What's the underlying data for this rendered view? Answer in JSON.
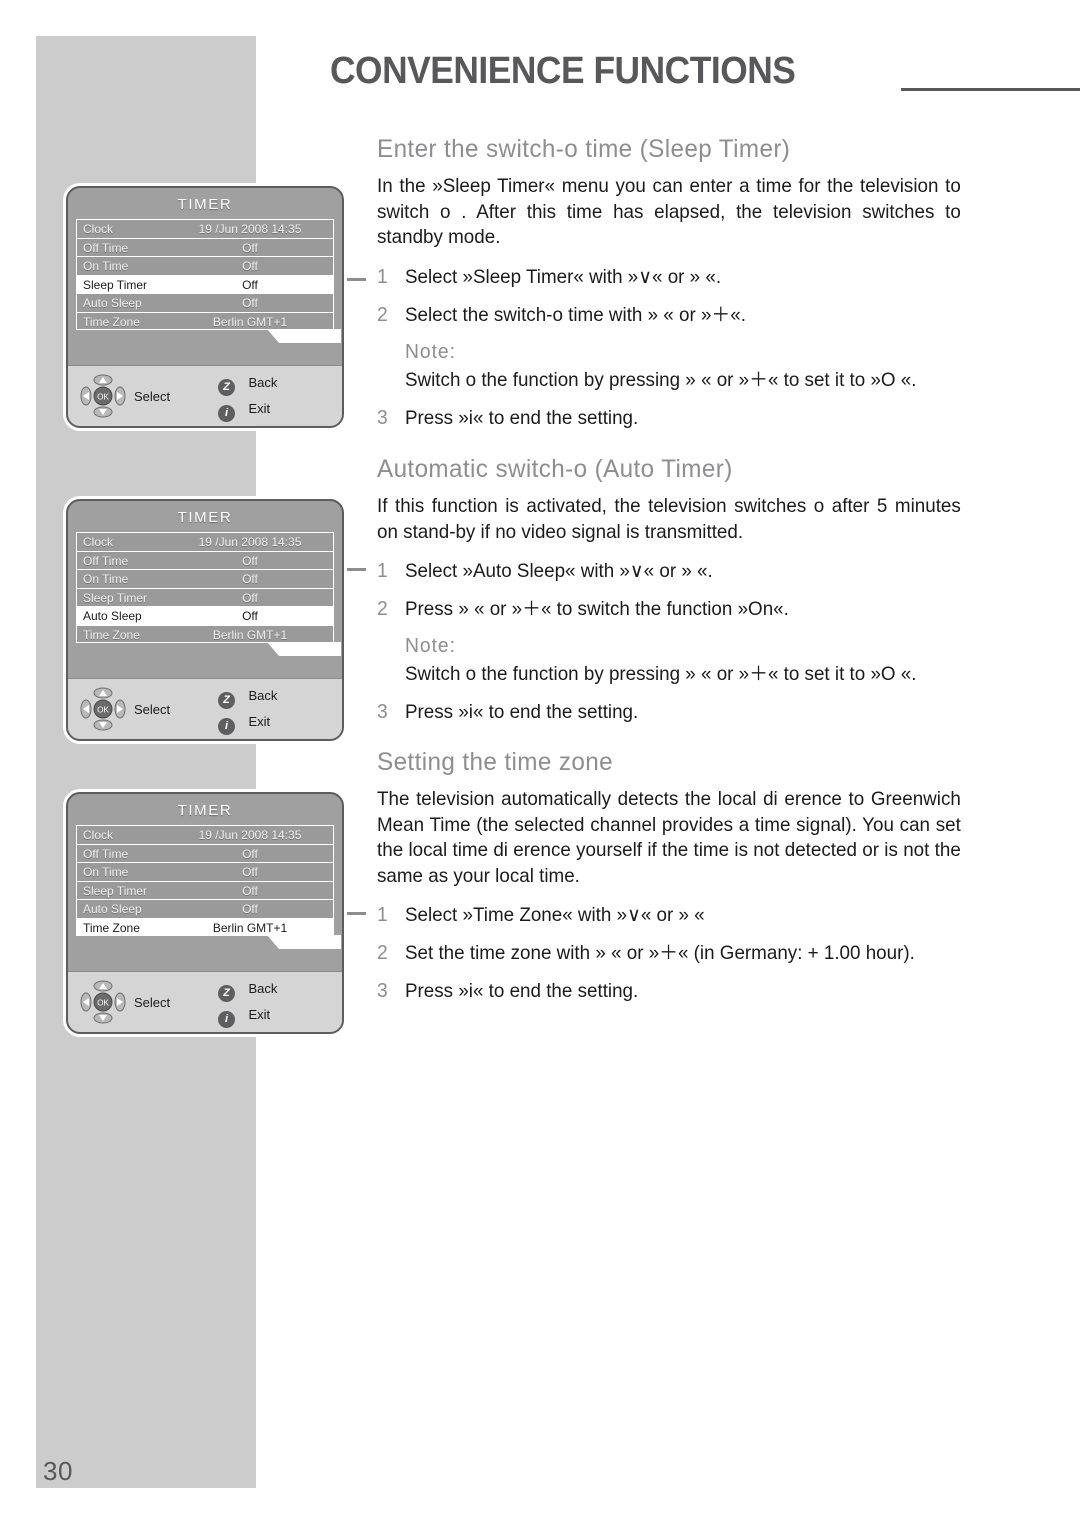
{
  "page": {
    "number": "30"
  },
  "chapter": {
    "title": "CONVENIENCE FUNCTIONS"
  },
  "sections": [
    {
      "heading": "Enter the switch-o   time (Sleep Timer)",
      "intro": "In the »Sleep Timer« menu you can enter a time for the television to switch o . After this time has elapsed, the television switches to standby mode.",
      "steps": [
        {
          "num": "1",
          "text": "Select »Sleep Timer« with »∨« or »   «."
        },
        {
          "num": "2",
          "text": "Select the switch-o   time with »    « or »＋«."
        }
      ],
      "note": {
        "label": "Note:",
        "text": "Switch o   the function by pressing »    « or »＋« to set it to »O  «."
      },
      "final_step": {
        "num": "3",
        "text": "Press »i« to end the setting."
      }
    },
    {
      "heading": "Automatic switch-o   (Auto Timer)",
      "intro": "If this function is activated, the television switches o   after 5 minutes on stand-by if no video signal is transmitted.",
      "steps": [
        {
          "num": "1",
          "text": "Select »Auto Sleep« with »∨« or »   «."
        },
        {
          "num": "2",
          "text": "Press »    « or »＋« to switch the function »On«."
        }
      ],
      "note": {
        "label": "Note:",
        "text": "Switch o   the function by pressing »    « or »＋« to set it to »O  «."
      },
      "final_step": {
        "num": "3",
        "text": "Press »i« to end the setting."
      }
    },
    {
      "heading": "Setting the time zone",
      "intro": "The television automatically detects the local di  erence to Greenwich Mean Time (the selected channel provides a time signal). You can set the local time di  erence yourself if the time is not detected or is not the same as your local time.",
      "steps": [
        {
          "num": "1",
          "text": "Select »Time Zone« with »∨« or »   «"
        },
        {
          "num": "2",
          "text": "Set the time zone with »    « or »＋« (in Germany: + 1.00 hour)."
        }
      ],
      "note": null,
      "final_step": {
        "num": "3",
        "text": "Press »i« to end the setting."
      }
    }
  ],
  "osd_menus": [
    {
      "title": "TIMER",
      "selected": "Sleep Timer",
      "rows": [
        {
          "label": "Clock",
          "value": "19 /Jun 2008 14:35"
        },
        {
          "label": "Off Time",
          "value": "Off"
        },
        {
          "label": "On Time",
          "value": "Off"
        },
        {
          "label": "Sleep Timer",
          "value": "Off"
        },
        {
          "label": "Auto Sleep",
          "value": "Off"
        },
        {
          "label": "Time Zone",
          "value": "Berlin GMT+1"
        }
      ],
      "footer": {
        "select": "Select",
        "back_key": "Z",
        "back": "Back",
        "exit_key": "i",
        "exit": "Exit",
        "ok": "OK"
      }
    },
    {
      "title": "TIMER",
      "selected": "Auto Sleep",
      "rows": [
        {
          "label": "Clock",
          "value": "19 /Jun 2008 14:35"
        },
        {
          "label": "Off Time",
          "value": "Off"
        },
        {
          "label": "On Time",
          "value": "Off"
        },
        {
          "label": "Sleep Timer",
          "value": "Off"
        },
        {
          "label": "Auto Sleep",
          "value": "Off"
        },
        {
          "label": "Time Zone",
          "value": "Berlin GMT+1"
        }
      ],
      "footer": {
        "select": "Select",
        "back_key": "Z",
        "back": "Back",
        "exit_key": "i",
        "exit": "Exit",
        "ok": "OK"
      }
    },
    {
      "title": "TIMER",
      "selected": "Time Zone",
      "rows": [
        {
          "label": "Clock",
          "value": "19 /Jun 2008 14:35"
        },
        {
          "label": "Off Time",
          "value": "Off"
        },
        {
          "label": "On Time",
          "value": "Off"
        },
        {
          "label": "Sleep Timer",
          "value": "Off"
        },
        {
          "label": "Auto Sleep",
          "value": "Off"
        },
        {
          "label": "Time Zone",
          "value": "Berlin GMT+1"
        }
      ],
      "footer": {
        "select": "Select",
        "back_key": "Z",
        "back": "Back",
        "exit_key": "i",
        "exit": "Exit",
        "ok": "OK"
      }
    }
  ],
  "colors": {
    "band": "#cccccc",
    "heading": "#8e8e90",
    "body": "#1b1b1b",
    "osd_bg": "#a0a0a0",
    "osd_row": "#9a9a9a",
    "osd_selected": "#ffffff",
    "osd_footer": "#d5d5d5"
  }
}
